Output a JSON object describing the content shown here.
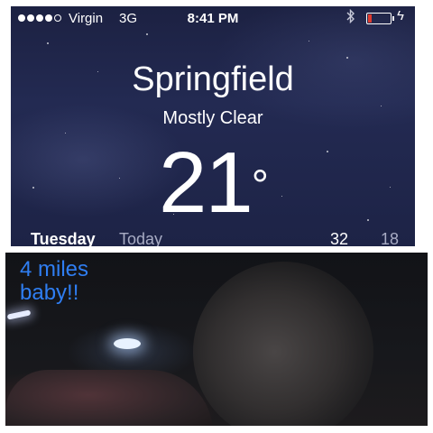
{
  "status_bar": {
    "carrier": "Virgin",
    "network": "3G",
    "time": "8:41 PM",
    "bluetooth_icon": "bluetooth-icon",
    "battery_icon": "battery-low-icon",
    "charging_icon": "charging-bolt-icon",
    "battery_level": 0.15,
    "signal_bars_filled": 4,
    "signal_bars_total": 5
  },
  "weather": {
    "city": "Springfield",
    "condition": "Mostly Clear",
    "temperature": "21",
    "degree_symbol": "°",
    "day": "Tuesday",
    "day_label": "Today",
    "high": "32",
    "low": "18"
  },
  "photo": {
    "caption_line1": "4 miles",
    "caption_line2": "baby!!"
  },
  "colors": {
    "sky": "#1f2548",
    "caption": "#2f7ef2",
    "battery_fill": "#e03a2e"
  }
}
